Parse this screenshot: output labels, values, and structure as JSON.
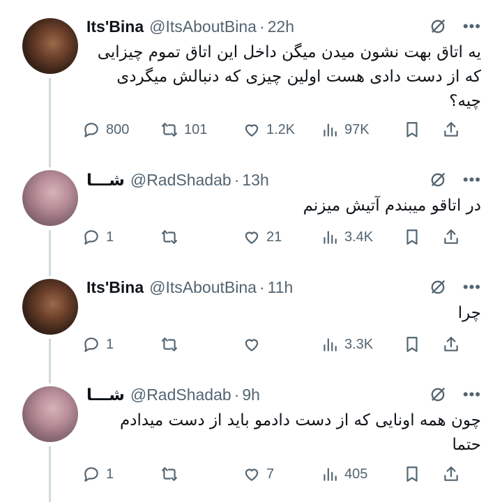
{
  "tweets": [
    {
      "display_name": "Its'Bina",
      "handle": "@ItsAboutBina",
      "time": "22h",
      "text": "یه اتاق بهت نشون میدن میگن داخل این اتاق تموم چیزایی که از دست دادی هست اولین چیزی که دنبالش میگردی چیه؟",
      "replies": "800",
      "retweets": "101",
      "likes": "1.2K",
      "views": "97K"
    },
    {
      "display_name": "شـــا",
      "handle": "@RadShadab",
      "time": "13h",
      "text": "در اتاقو میبندم آتیش میزنم",
      "replies": "1",
      "retweets": "",
      "likes": "21",
      "views": "3.4K"
    },
    {
      "display_name": "Its'Bina",
      "handle": "@ItsAboutBina",
      "time": "11h",
      "text": "چرا",
      "replies": "1",
      "retweets": "",
      "likes": "",
      "views": "3.3K"
    },
    {
      "display_name": "شـــا",
      "handle": "@RadShadab",
      "time": "9h",
      "text": "چون همه اونایی که از دست دادمو باید از دست میدادم حتما",
      "replies": "1",
      "retweets": "",
      "likes": "7",
      "views": "405"
    }
  ],
  "header": {
    "separator": "·",
    "more": "•••"
  },
  "icons": {
    "reply": "reply-icon",
    "retweet": "retweet-icon",
    "like": "heart-icon",
    "views": "views-icon",
    "bookmark": "bookmark-icon",
    "share": "share-icon",
    "grok": "grok-icon"
  },
  "colors": {
    "text": "#0f1419",
    "secondary": "#536471",
    "thread_line": "#cfd9de"
  }
}
